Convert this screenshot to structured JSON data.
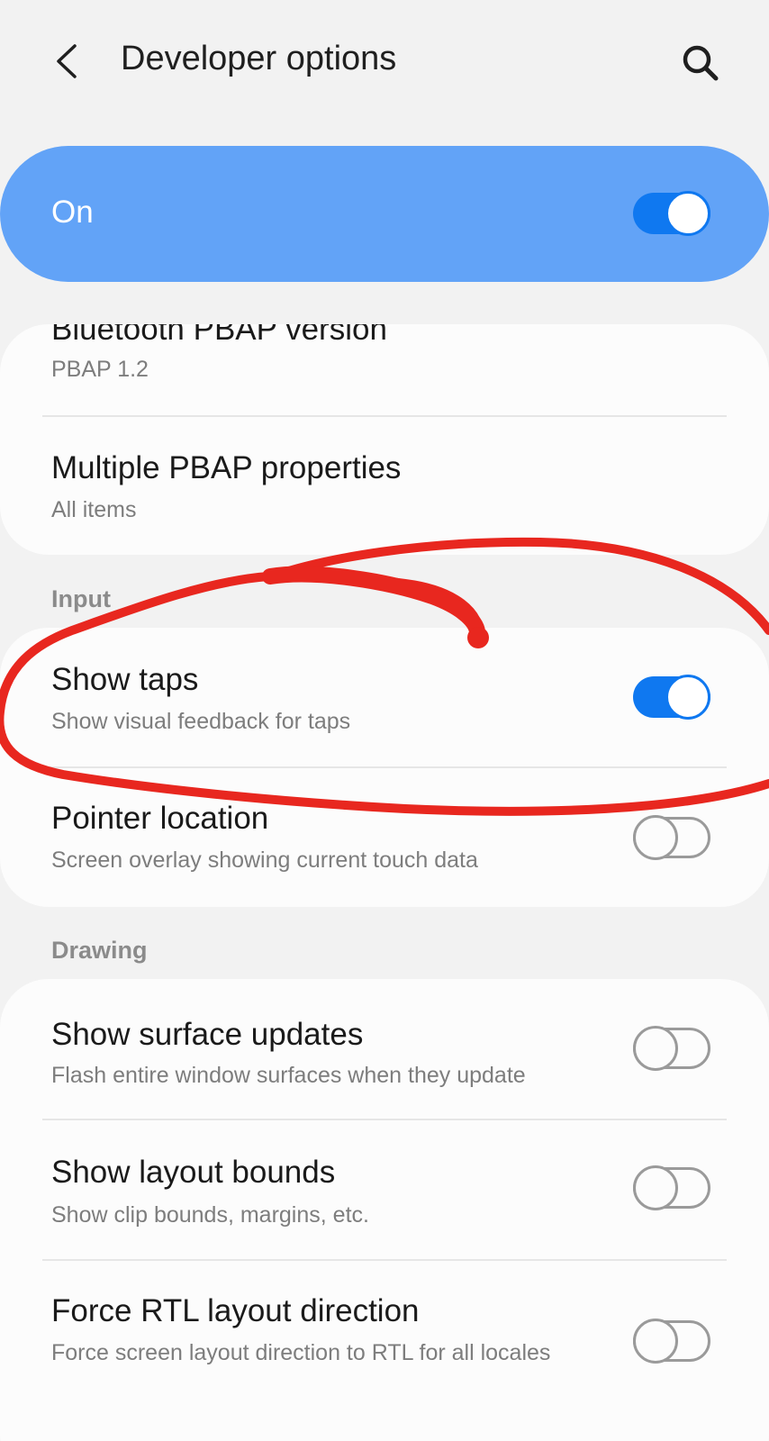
{
  "header": {
    "back_icon": "chevron-left-icon",
    "title": "Developer options",
    "search_icon": "search-icon"
  },
  "master_switch": {
    "label": "On",
    "state": true
  },
  "group_top": {
    "items": [
      {
        "title": "Bluetooth PBAP version",
        "subtitle": "PBAP 1.2"
      },
      {
        "title": "Multiple PBAP properties",
        "subtitle": "All items"
      }
    ]
  },
  "section_input": {
    "label": "Input",
    "items": [
      {
        "title": "Show taps",
        "subtitle": "Show visual feedback for taps",
        "toggle": true
      },
      {
        "title": "Pointer location",
        "subtitle": "Screen overlay showing current touch data",
        "toggle": false
      }
    ]
  },
  "section_drawing": {
    "label": "Drawing",
    "items": [
      {
        "title": "Show surface updates",
        "subtitle": "Flash entire window surfaces when they update",
        "toggle": false
      },
      {
        "title": "Show layout bounds",
        "subtitle": "Show clip bounds, margins, etc.",
        "toggle": false
      },
      {
        "title": "Force RTL layout direction",
        "subtitle": "Force screen layout direction to RTL for all locales",
        "toggle": false
      }
    ]
  },
  "colors": {
    "accent": "#0f78f0",
    "master_background": "#62a3f7",
    "annotation_stroke": "#e8271f"
  }
}
